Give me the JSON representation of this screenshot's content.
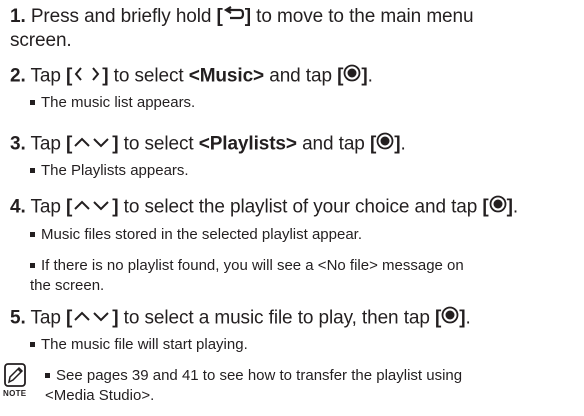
{
  "steps": [
    {
      "num": "1.",
      "pre": " Press and briefly hold ",
      "key_open": "[",
      "key_icon": "back-icon",
      "key_close": "]",
      "post": " to move to the main menu",
      "cont": "screen."
    },
    {
      "num": "2.",
      "pre": " Tap ",
      "key_open": "[",
      "key_icon": "left-right-arrows-icon",
      "key_close": "]",
      "mid": " to select ",
      "target": "<Music>",
      "mid2": " and tap ",
      "select_open": "[",
      "select_icon": "select-button-icon",
      "select_close": "]",
      "end": ".",
      "bullets": [
        "The music list appears."
      ]
    },
    {
      "num": "3.",
      "pre": " Tap ",
      "key_open": "[",
      "key_icon": "up-down-arrows-icon",
      "key_close": "]",
      "mid": " to select ",
      "target": "<Playlists>",
      "mid2": " and tap ",
      "select_open": "[",
      "select_icon": "select-button-icon",
      "select_close": "]",
      "end": ".",
      "bullets": [
        "The Playlists appears."
      ]
    },
    {
      "num": "4.",
      "pre": " Tap ",
      "key_open": "[",
      "key_icon": "up-down-arrows-icon",
      "key_close": "]",
      "mid": " to select the playlist of your choice and tap ",
      "select_open": "[",
      "select_icon": "select-button-icon",
      "select_close": "]",
      "end": ".",
      "bullets": [
        "Music files stored in the selected playlist appear.",
        "If there is no playlist found, you will see a <No file> message on",
        "the screen."
      ]
    },
    {
      "num": "5.",
      "pre": " Tap ",
      "key_open": "[",
      "key_icon": "up-down-arrows-icon",
      "key_close": "]",
      "mid": " to select a music file to play, then tap ",
      "select_open": "[",
      "select_icon": "select-button-icon",
      "select_close": "]",
      "end": ".",
      "bullets": [
        "The music file will start playing."
      ]
    }
  ],
  "note": {
    "icon": "note-icon",
    "label": "NOTE",
    "line1": "See pages 39 and 41 to see how to transfer the playlist using",
    "line2": "<Media Studio>."
  }
}
